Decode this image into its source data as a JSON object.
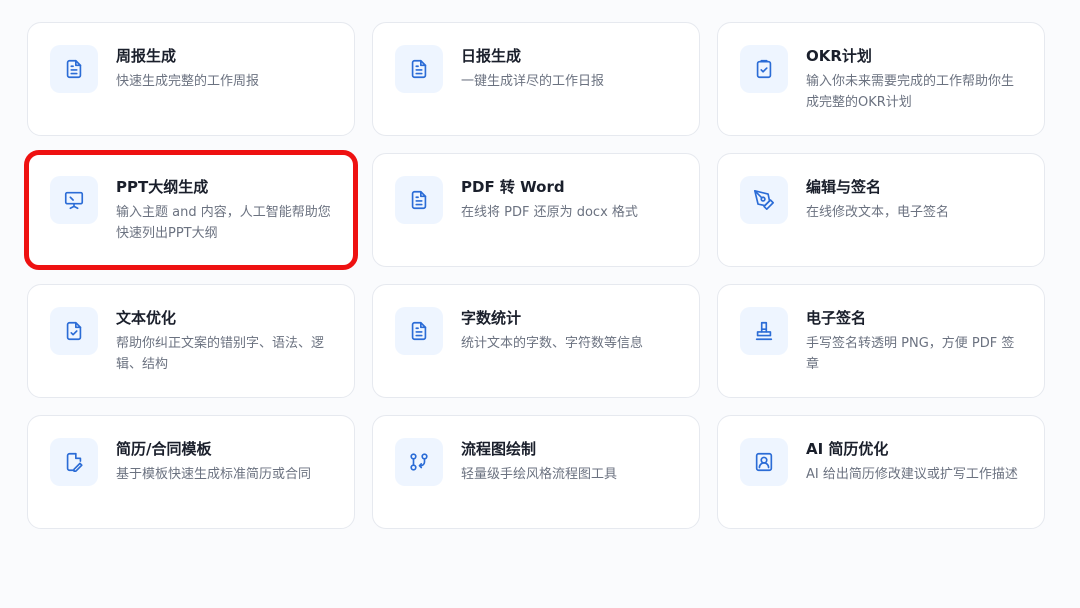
{
  "cards": [
    {
      "title": "周报生成",
      "desc": "快速生成完整的工作周报"
    },
    {
      "title": "日报生成",
      "desc": "一键生成详尽的工作日报"
    },
    {
      "title": "OKR计划",
      "desc": "输入你未来需要完成的工作帮助你生成完整的OKR计划"
    },
    {
      "title": "PPT大纲生成",
      "desc": "输入主题 and 内容，人工智能帮助您快速列出PPT大纲"
    },
    {
      "title": "PDF 转 Word",
      "desc": "在线将 PDF 还原为 docx 格式"
    },
    {
      "title": "编辑与签名",
      "desc": "在线修改文本，电子签名"
    },
    {
      "title": "文本优化",
      "desc": "帮助你纠正文案的错别字、语法、逻辑、结构"
    },
    {
      "title": "字数统计",
      "desc": "统计文本的字数、字符数等信息"
    },
    {
      "title": "电子签名",
      "desc": "手写签名转透明 PNG，方便 PDF 签章"
    },
    {
      "title": "简历/合同模板",
      "desc": "基于模板快速生成标准简历或合同"
    },
    {
      "title": "流程图绘制",
      "desc": "轻量级手绘风格流程图工具"
    },
    {
      "title": "AI 简历优化",
      "desc": "AI 给出简历修改建议或扩写工作描述"
    }
  ],
  "icons": {
    "card_0": "document-icon",
    "card_1": "document-icon",
    "card_2": "clipboard-check-icon",
    "card_3": "presentation-icon",
    "card_4": "document-icon",
    "card_5": "pen-nib-icon",
    "card_6": "document-check-icon",
    "card_7": "document-icon",
    "card_8": "stamp-icon",
    "card_9": "document-edit-icon",
    "card_10": "flow-nodes-icon",
    "card_11": "user-portrait-icon"
  },
  "colors": {
    "accent": "#2b6cd6",
    "icon_bg": "#eef5ff",
    "highlight": "#ee1111"
  }
}
